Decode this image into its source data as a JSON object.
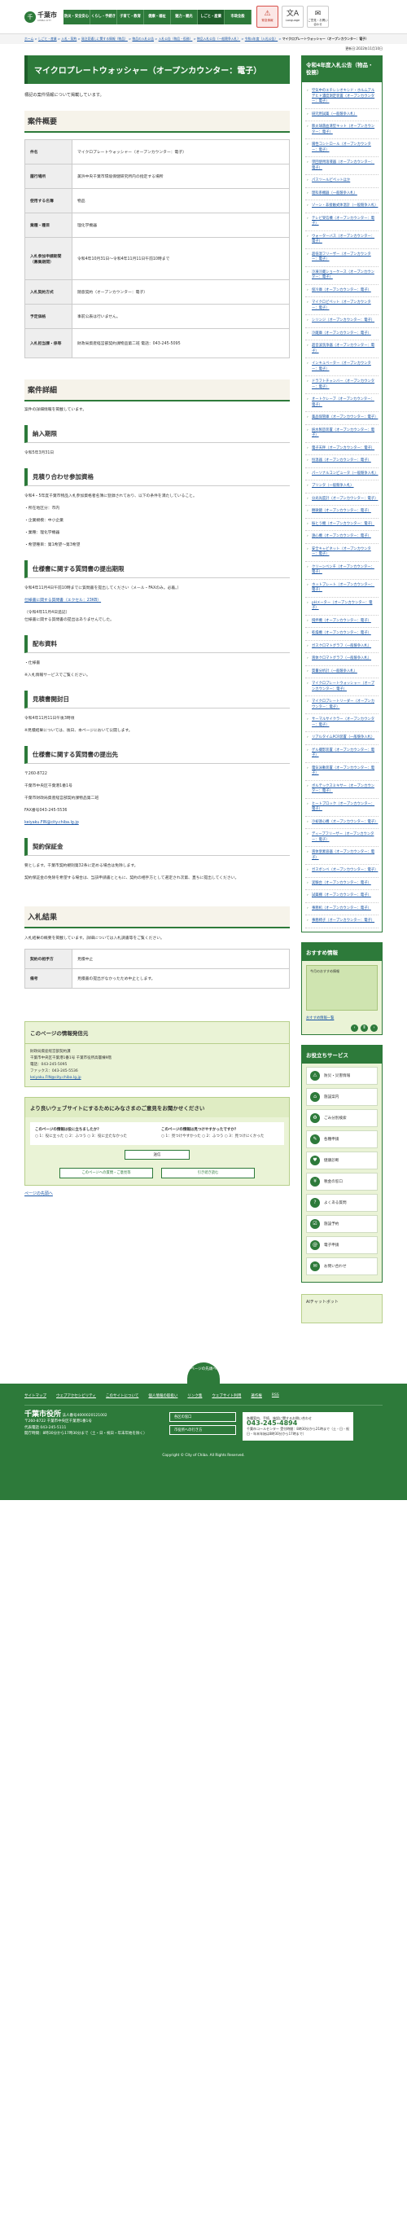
{
  "header": {
    "logo": "千葉市",
    "logo_sub": "CHIBA CITY",
    "nav": [
      "防災・安全安心",
      "くらし・手続き",
      "子育て・教育",
      "健康・福祉",
      "魅力・観光",
      "しごと・産業",
      "市政全般"
    ],
    "tools": [
      {
        "label": "緊急情報",
        "icon": "⚠"
      },
      {
        "label": "Language",
        "icon": "文A"
      },
      {
        "label": "ご意見・お問い合わせ",
        "icon": "✉"
      }
    ]
  },
  "breadcrumb": [
    "ホーム",
    "しごと・産業",
    "入札・契約",
    "発注見通しに関する情報（物品）",
    "物品の入札公告",
    "入札公告（物品・役務）",
    "物品入札公告（一般競争入札）",
    "令和4年度（入札公告）",
    "マイクロプレートウォッシャー（オープンカウンター：電子）"
  ],
  "update": "更新日:2022年11月10日",
  "page_title": "マイクロプレートウォッシャー（オープンカウンター：電子）",
  "lead": "標記の案件情報について掲載しています。",
  "overview": {
    "heading": "案件概要",
    "rows": [
      {
        "k": "件名",
        "v": "マイクロプレートウォッシャー（オープンカウンター：電子）"
      },
      {
        "k": "履行場所",
        "v": "美浜中央千葉市環境保健研究所内の指定する場所"
      },
      {
        "k": "使用する名簿",
        "v": "物品"
      },
      {
        "k": "業種・種目",
        "v": "理化学機器"
      },
      {
        "k": "入札参加申請期間（募集期間）",
        "v": "令和4年10月31日～令和4年11月11日午前10時まで"
      },
      {
        "k": "入札契約方式",
        "v": "随意契約（オープンカウンター：電子）"
      },
      {
        "k": "予定価格",
        "v": "事前公表は行いません。"
      },
      {
        "k": "入札担当課・係等",
        "v": "財政局資産経営部契約課物品第二班  電話：043-245-5095"
      }
    ]
  },
  "detail": {
    "heading": "案件詳細",
    "intro": "案件の詳細情報を掲載しています。",
    "sections": [
      {
        "h": "納入期限",
        "lines": [
          "令和5年3月31日"
        ]
      },
      {
        "h": "見積り合わせ参加資格",
        "lines": [
          "令和4・5年度千葉市物品入札参加資格者名簿に登録されており、以下の条件を満たしていること。",
          "・所在地区分：市内",
          "・企業規模：中小企業",
          "・業種：理化学機器",
          "・希望種目：第1希望～第3希望"
        ]
      },
      {
        "h": "仕様書に関する質問書の提出期限",
        "lines": [
          "令和4年11月4日午前10時までに質問書を提出してください（メール・FAXのみ。必着。）",
          "仕様書に関する質問書（エクセル：23KB）",
          "（令和4年11月4日追記）",
          "仕様書に関する質問書の提出はありませんでした。"
        ]
      },
      {
        "h": "配布資料",
        "lines": [
          "・仕様書",
          "※入札情報サービスでご覧ください。"
        ]
      },
      {
        "h": "見積書開封日",
        "lines": [
          "令和4年11月11日午後3時頃",
          "※見積結果については、後日、本ページにおいて公開します。"
        ]
      },
      {
        "h": "仕様書に関する質問書の提出先",
        "lines": [
          "〒260-8722",
          "千葉市中央区千葉港1番1号",
          "千葉市財政局資産経営部契約課物品第二班",
          "FAX番号043-245-5536",
          "keiyaku.FIN@city.chiba.lg.jp"
        ]
      },
      {
        "h": "契約保証金",
        "lines": [
          "要とします。千葉市契約規則第32条に定める場合は免除します。",
          "契約保証金の免除を希望する場合は、当該申請書とともに、契約の相手方として選定され次第、直ちに提出してください。"
        ]
      }
    ]
  },
  "result": {
    "heading": "入札結果",
    "intro": "入札結果の概要を掲載しています。詳細については入札調書等をご覧ください。",
    "rows": [
      {
        "k": "契約の相手方",
        "v": "見積中止"
      },
      {
        "k": "備考",
        "v": "見積書の提出がなかったため中止とします。"
      }
    ]
  },
  "contact": {
    "heading": "このページの情報発信元",
    "lines": [
      "財政局資産経営部契約課",
      "千葉市中央区千葉港1番1号 千葉市役所高層棟9階",
      "電話：043-245-5095",
      "ファックス：043-245-5536"
    ],
    "email": "keiyaku.FIN@city.chiba.lg.jp"
  },
  "survey": {
    "heading": "より良いウェブサイトにするためにみなさまのご意見をお聞かせください",
    "q1": "このページの情報は役に立ちましたか？",
    "q1_opts": "○ 1：役に立った  ○ 2：ふつう  ○ 3：役に立たなかった",
    "q2": "このページの情報は見つけやすかったですか？",
    "q2_opts": "○ 1：見つけやすかった  ○ 2：ふつう  ○ 3：見つけにくかった",
    "send": "送信",
    "link1": "このページへの質問・ご意見等",
    "link2": "引き続き読む"
  },
  "back": "ページの先頭へ",
  "sidebar": {
    "heading": "令和4年度入札公告（物品・役務）",
    "items": [
      "空気中のエチレンオキシド・ホルムアルデヒド濃度測定装置（オープンカウンター：電子）",
      "研究用試薬（一般競争入札）",
      "肺炎球菌血清型キット（オープンカウンター：電子）",
      "陽性コントロール（オープンカウンター：電子）",
      "単回使用溶液器（オープンカウンター：電子）",
      "パスツールピペットほか",
      "理科系機器（一般競争入札）",
      "ゾーン・非接触式体温計（一般競争入札）",
      "テレビ受信機（オープンカウンター：電子）",
      "ウォーターバス（オープンカウンター：電子）",
      "超低温フリーザー（オープンカウンター：電子）",
      "冷凍冷蔵ショーケース（オープンカウンター：電子）",
      "保冷庫（オープンカウンター：電子）",
      "マイクロピペット（オープンカウンター：電子）",
      "シリンジ（オープンカウンター：電子）",
      "冷蔵庫（オープンカウンター：電子）",
      "超音波洗浄器（オープンカウンター：電子）",
      "インキュベーター（オープンカウンター：電子）",
      "ドラフトチャンバー（オープンカウンター：電子）",
      "オートクレーブ（オープンカウンター：電子）",
      "薬品保管庫（オープンカウンター：電子）",
      "純水製造装置（オープンカウンター：電子）",
      "電子天秤（オープンカウンター：電子）",
      "恒温器（オープンカウンター：電子）",
      "パーソナルコンピュータ（一般競争入札）",
      "プリンタ（一般競争入札）",
      "分光光度計（オープンカウンター：電子）",
      "顕微鏡（オープンカウンター：電子）",
      "振とう機（オープンカウンター：電子）",
      "遠心機（オープンカウンター：電子）",
      "安全キャビネット（オープンカウンター：電子）",
      "クリーンベンチ（オープンカウンター：電子）",
      "ホットプレート（オープンカウンター：電子）",
      "pHメーター（オープンカウンター：電子）",
      "撹拌機（オープンカウンター：電子）",
      "乾燥機（オープンカウンター：電子）",
      "ガスクロマトグラフ（一般競争入札）",
      "液体クロマトグラフ（一般競争入札）",
      "質量分析計（一般競争入札）",
      "マイクロプレートウォッシャー（オープンカウンター：電子）",
      "マイクロプレートリーダー（オープンカウンター：電子）",
      "サーマルサイクラー（オープンカウンター：電子）",
      "リアルタイムPCR装置（一般競争入札）",
      "ゲル撮影装置（オープンカウンター：電子）",
      "電気泳動装置（オープンカウンター：電子）",
      "ボルテックスミキサー（オープンカウンター：電子）",
      "ヒートブロック（オープンカウンター：電子）",
      "冷却遠心機（オープンカウンター：電子）",
      "ディープフリーザー（オープンカウンター：電子）",
      "液体窒素容器（オープンカウンター：電子）",
      "ガスボンベ（オープンカウンター：電子）",
      "実験台（オープンカウンター：電子）",
      "試薬棚（オープンカウンター：電子）",
      "事務机（オープンカウンター：電子）",
      "事務椅子（オープンカウンター：電子）"
    ]
  },
  "recommend": {
    "heading": "おすすめ情報",
    "banner": "今月のおすすめ情報",
    "link": "おすすめ情報一覧"
  },
  "services": {
    "heading": "お役立ちサービス",
    "items": [
      {
        "label": "防災・災害情報",
        "icon": "⚠"
      },
      {
        "label": "施設案内",
        "icon": "⌂"
      },
      {
        "label": "ごみ分別検索",
        "icon": "♻"
      },
      {
        "label": "各種申請",
        "icon": "✎"
      },
      {
        "label": "健康診断",
        "icon": "♥"
      },
      {
        "label": "税金の窓口",
        "icon": "¥"
      },
      {
        "label": "よくある質問",
        "icon": "?"
      },
      {
        "label": "施設予約",
        "icon": "☑"
      },
      {
        "label": "電子申請",
        "icon": "@"
      },
      {
        "label": "お問い合わせ",
        "icon": "✉"
      }
    ]
  },
  "chat": "AIチャットボット",
  "footer": {
    "pagetop": "ページの先頭へ",
    "links": [
      "サイトマップ",
      "ウェブアクセシビリティ",
      "このサイトについて",
      "個人情報の取扱い",
      "リンク集",
      "ウェブサイト利用",
      "著作権",
      "RSS"
    ],
    "org": "千葉市役所",
    "number": "法人番号4000020121002",
    "lines": [
      "〒260-8722 千葉市中央区千葉港1番1号",
      "代表電話 043-245-5111",
      "開庁時間：8時30分から17時30分まで（土・日・祝日・年末年始を除く）"
    ],
    "btn1": "各区の窓口",
    "btn2": "市役所への行き方",
    "call_title": "各種案内、手続、施設に関するお問い合わせ",
    "call_number": "043-245-4894",
    "call_note": "千葉市コールセンター  受付時間：8時30分から21時まで（土・日・祝日・年末年始は8時30分から17時まで）",
    "copy": "Copyright © City of Chiba. All Rights Reserved."
  }
}
